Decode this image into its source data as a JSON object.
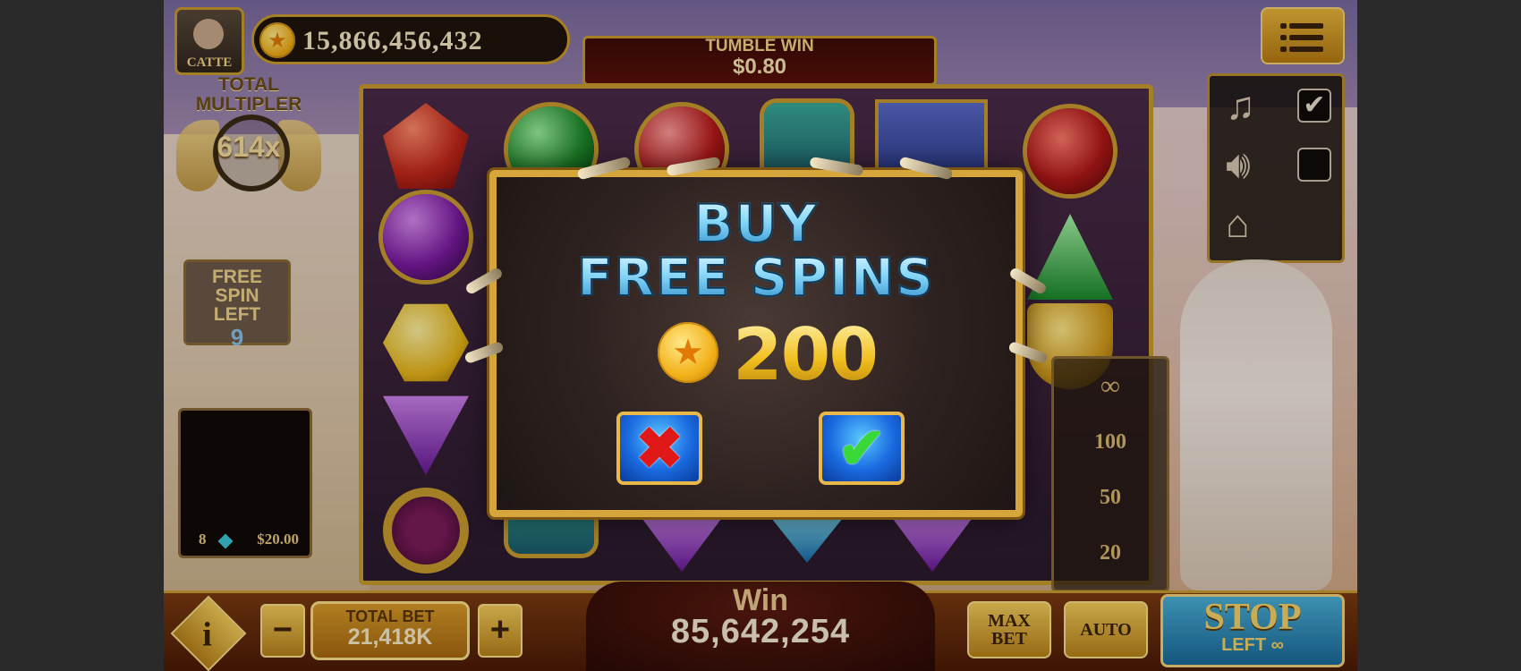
{
  "player": {
    "name": "CATTE",
    "balance": "15,866,456,432"
  },
  "tumble_win": {
    "label": "TUMBLE WIN",
    "amount": "$0.80"
  },
  "total_multiplier": {
    "label": "TOTAL MULTIPLER",
    "value": "614x"
  },
  "free_spin": {
    "label": "FREE SPIN LEFT",
    "value": "9"
  },
  "history": {
    "count": "8",
    "amount": "$20.00"
  },
  "sound_panel": {
    "music_checked": true,
    "sound_checked": false,
    "check_glyph": "✔"
  },
  "autospin_options": [
    "∞",
    "100",
    "50",
    "20"
  ],
  "bottom_bar": {
    "info_label": "i",
    "minus_label": "−",
    "plus_label": "+",
    "total_bet_label": "TOTAL BET",
    "total_bet_value": "21,418K",
    "win_label": "Win",
    "win_value": "85,642,254",
    "max_bet_line1": "MAX",
    "max_bet_line2": "BET",
    "auto_label": "AUTO",
    "stop_label": "STOP",
    "stop_sub": "LEFT ∞"
  },
  "modal": {
    "title_line1": "BUY",
    "title_line2": "FREE SPINS",
    "price": "200",
    "cancel_glyph": "✖",
    "confirm_glyph": "✔"
  },
  "icons": [
    "avatar",
    "coin-icon",
    "menu-icon",
    "music-icon",
    "speaker-icon",
    "home-icon",
    "info-icon",
    "cancel-icon",
    "confirm-icon"
  ],
  "colors": {
    "gold": "#c99b2e",
    "modal_title_blue": "#8ad8f8",
    "price_gold": "#f2c020",
    "stop_blue": "#1a6a9a"
  }
}
